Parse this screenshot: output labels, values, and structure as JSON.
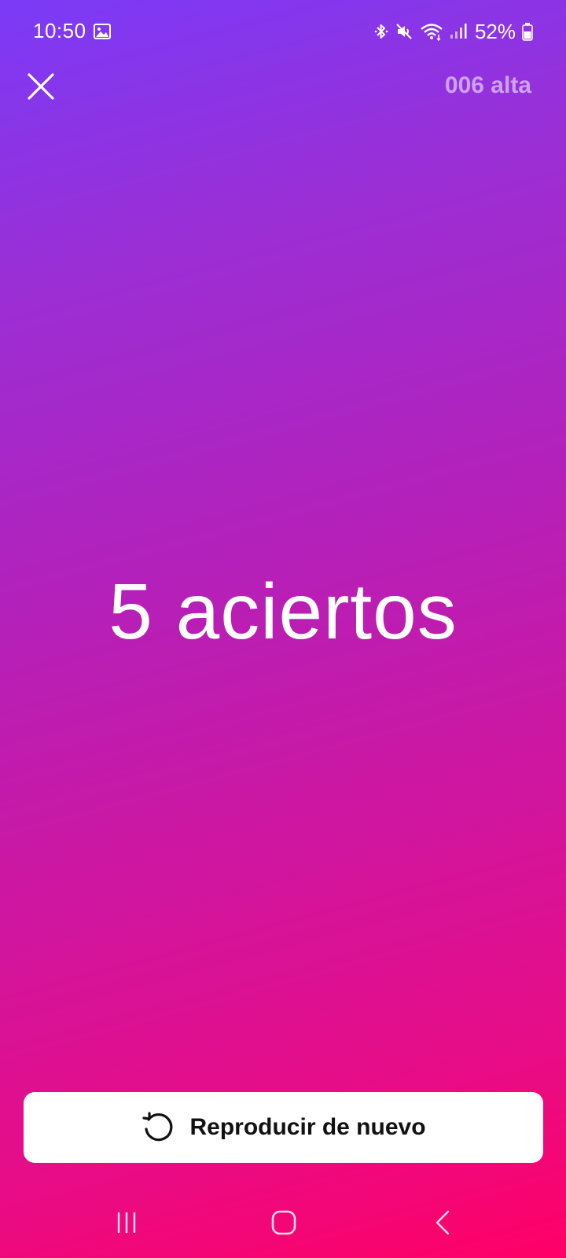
{
  "status_bar": {
    "time": "10:50",
    "battery_percent": "52%",
    "icons": [
      "gallery-icon",
      "bluetooth-icon",
      "mute-icon",
      "wifi-icon",
      "signal-icon",
      "battery-icon"
    ]
  },
  "header": {
    "close_icon": "close-icon",
    "title": "006 alta"
  },
  "result": {
    "text": "5 aciertos"
  },
  "replay": {
    "label": "Reproducir de nuevo",
    "icon": "replay-icon"
  },
  "nav": {
    "items": [
      "recent-apps-icon",
      "home-icon",
      "back-icon"
    ]
  },
  "colors": {
    "gradient_top": "#7b3af7",
    "gradient_bottom": "#ff0066",
    "button_bg": "#ffffff"
  }
}
